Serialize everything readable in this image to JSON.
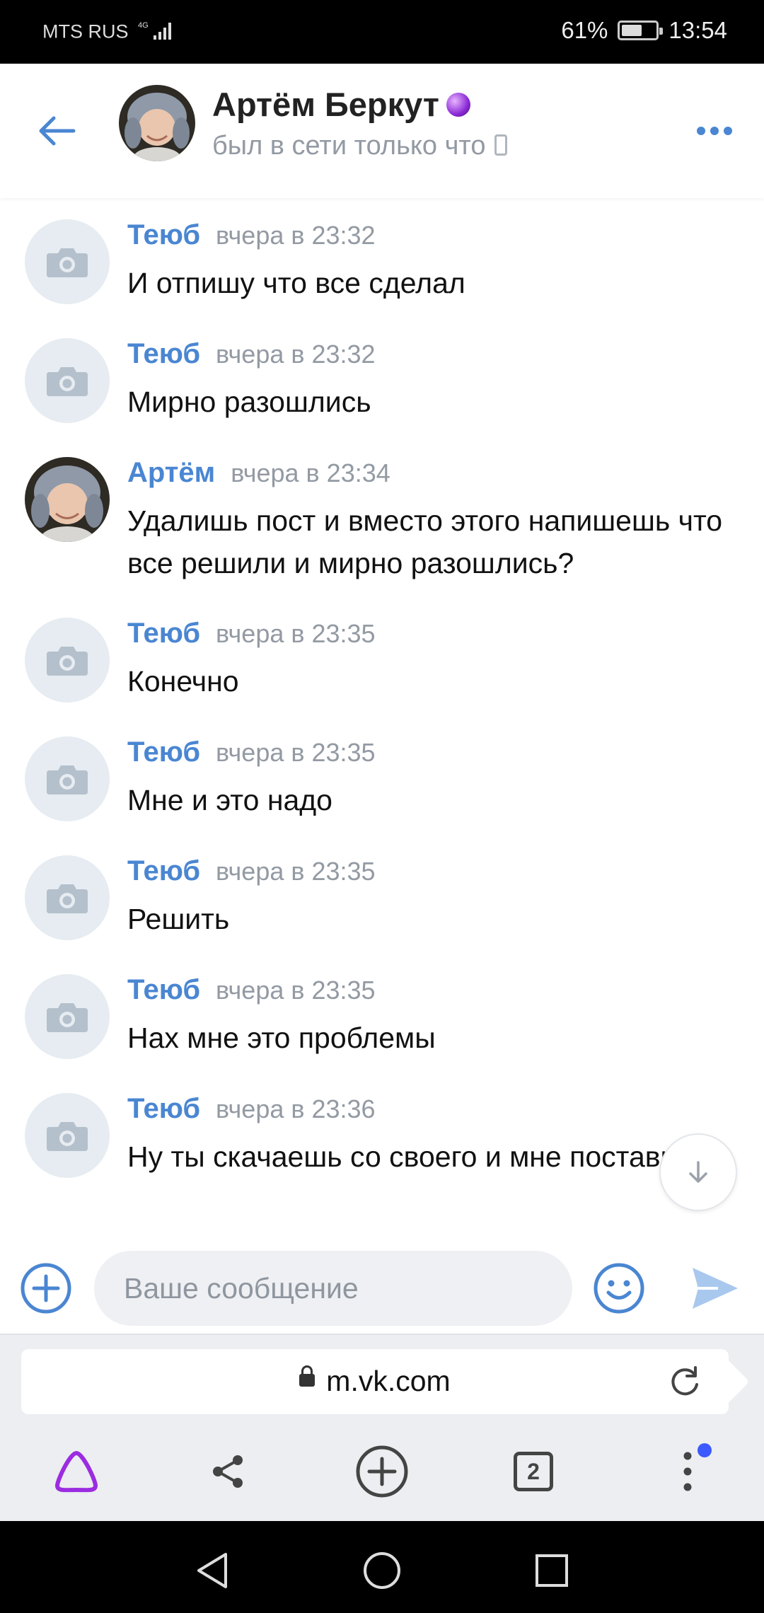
{
  "status_bar": {
    "carrier": "MTS RUS",
    "network": "4G",
    "battery_percent": "61%",
    "battery_level": 0.61,
    "time": "13:54"
  },
  "header": {
    "name": "Артём Беркут",
    "status": "был в сети только что",
    "icons": {
      "back": "back-arrow-icon",
      "more": "more-dots-icon",
      "online_device": "mobile-phone-icon",
      "badge": "crystal-ball-icon"
    }
  },
  "messages": [
    {
      "author": "Теюб",
      "time": "вчера в 23:32",
      "text": "И отпишу что все сделал",
      "avatar": "placeholder"
    },
    {
      "author": "Теюб",
      "time": "вчера в 23:32",
      "text": "Мирно разошлись",
      "avatar": "placeholder"
    },
    {
      "author": "Артём",
      "time": "вчера в 23:34",
      "text": "Удалишь пост и вместо этого напишешь что все решили и мирно разошлись?",
      "avatar": "photo"
    },
    {
      "author": "Теюб",
      "time": "вчера в 23:35",
      "text": "Конечно",
      "avatar": "placeholder"
    },
    {
      "author": "Теюб",
      "time": "вчера в 23:35",
      "text": "Мне и это надо",
      "avatar": "placeholder"
    },
    {
      "author": "Теюб",
      "time": "вчера в 23:35",
      "text": "Решить",
      "avatar": "placeholder"
    },
    {
      "author": "Теюб",
      "time": "вчера в 23:35",
      "text": "Нах мне это проблемы",
      "avatar": "placeholder"
    },
    {
      "author": "Теюб",
      "time": "вчера в 23:36",
      "text": "Ну ты скачаешь со своего и мне поставишь",
      "avatar": "placeholder"
    }
  ],
  "composer": {
    "placeholder": "Ваше сообщение",
    "value": "",
    "icons": {
      "attach": "add-circle-icon",
      "emoji": "emoji-icon",
      "send": "send-icon"
    }
  },
  "browser": {
    "url": "m.vk.com",
    "tabs_count": "2",
    "icons": {
      "lock": "lock-icon",
      "reload": "reload-icon",
      "assistant": "alice-icon",
      "share": "share-icon",
      "new_tab": "new-tab-icon",
      "menu": "kebab-menu-icon"
    }
  },
  "colors": {
    "accent": "#4a86d2",
    "meta": "#939aa3",
    "send_disabled": "#a9c8ee",
    "assistant": "#9b2ce0",
    "notification_dot": "#3d5afe"
  }
}
